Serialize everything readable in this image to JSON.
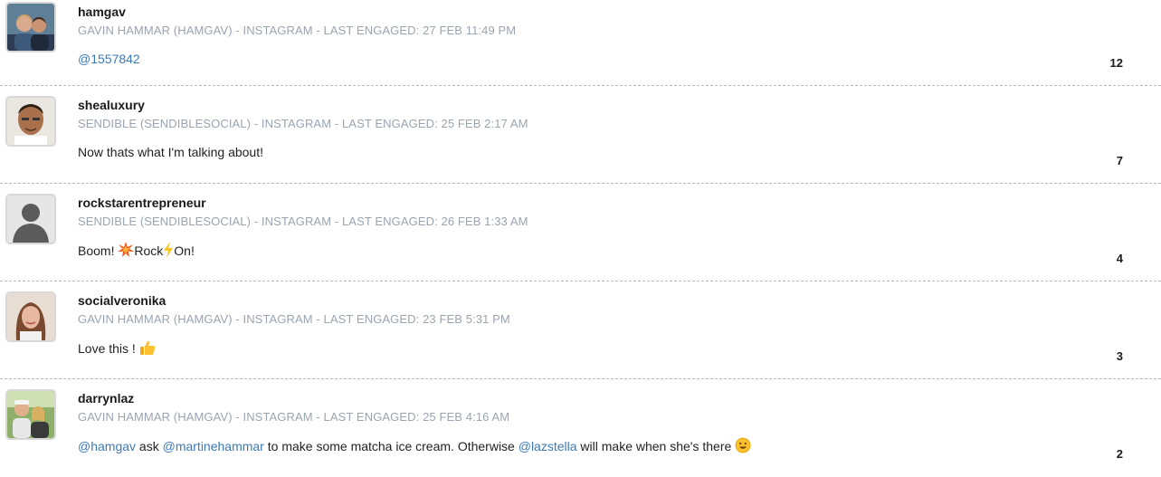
{
  "engagements": [
    {
      "username": "hamgav",
      "meta": "GAVIN HAMMAR (HAMGAV) - INSTAGRAM - LAST ENGAGED: 27 FEB 11:49 PM",
      "message_parts": [
        {
          "type": "mention",
          "text": "@1557842"
        }
      ],
      "count": "12",
      "avatar_icon": "user-photo-couple"
    },
    {
      "username": "shealuxury",
      "meta": "SENDIBLE (SENDIBLESOCIAL) - INSTAGRAM - LAST ENGAGED: 25 FEB 2:17 AM",
      "message_parts": [
        {
          "type": "text",
          "text": "Now thats what I'm talking about!"
        }
      ],
      "count": "7",
      "avatar_icon": "user-photo-man"
    },
    {
      "username": "rockstarentrepreneur",
      "meta": "SENDIBLE (SENDIBLESOCIAL) - INSTAGRAM - LAST ENGAGED: 26 FEB 1:33 AM",
      "message_parts": [
        {
          "type": "text",
          "text": "Boom! "
        },
        {
          "type": "emoji",
          "name": "collision-emoji"
        },
        {
          "type": "text",
          "text": "Rock"
        },
        {
          "type": "emoji",
          "name": "lightning-emoji"
        },
        {
          "type": "text",
          "text": "On!"
        }
      ],
      "count": "4",
      "avatar_icon": "default-user-silhouette"
    },
    {
      "username": "socialveronika",
      "meta": "GAVIN HAMMAR (HAMGAV) - INSTAGRAM - LAST ENGAGED: 23 FEB 5:31 PM",
      "message_parts": [
        {
          "type": "text",
          "text": "Love this ! "
        },
        {
          "type": "emoji",
          "name": "thumbs-up-emoji"
        }
      ],
      "count": "3",
      "avatar_icon": "user-photo-woman"
    },
    {
      "username": "darrynlaz",
      "meta": "GAVIN HAMMAR (HAMGAV) - INSTAGRAM - LAST ENGAGED: 25 FEB 4:16 AM",
      "message_parts": [
        {
          "type": "mention",
          "text": "@hamgav"
        },
        {
          "type": "text",
          "text": " ask "
        },
        {
          "type": "mention",
          "text": "@martinehammar"
        },
        {
          "type": "text",
          "text": " to make some matcha ice cream. Otherwise "
        },
        {
          "type": "mention",
          "text": "@lazstella"
        },
        {
          "type": "text",
          "text": " will make when she's there "
        },
        {
          "type": "emoji",
          "name": "smiley-emoji"
        }
      ],
      "count": "2",
      "avatar_icon": "user-photo-group"
    }
  ],
  "colors": {
    "mention": "#3b79b7",
    "meta": "#9aa4b0",
    "divider": "#b8b8b8"
  }
}
